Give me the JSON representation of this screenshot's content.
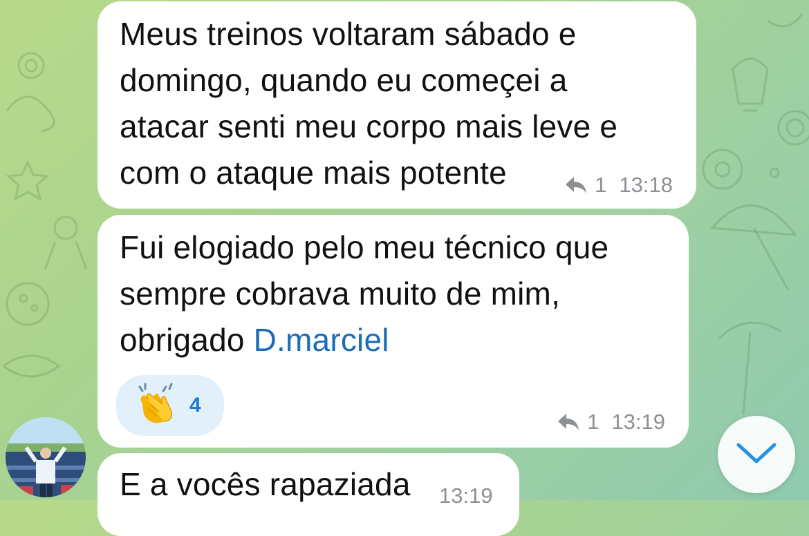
{
  "messages": [
    {
      "text_lines": [
        "Meus treinos voltaram sábado e",
        "domingo, quando eu começei a",
        "atacar senti meu corpo mais leve e",
        "com o ataque mais potente"
      ],
      "reply_count": "1",
      "time": "13:18"
    },
    {
      "text_lines": [
        "Fui elogiado pelo meu técnico que",
        "sempre cobrava muito de mim,",
        "obrigado "
      ],
      "mention": "D.marciel",
      "reaction": {
        "emoji_icon": "clapping-hands-icon",
        "count": "4"
      },
      "reply_count": "1",
      "time": "13:19"
    },
    {
      "text_lines": [
        "E a vocês rapaziada"
      ],
      "time": "13:19"
    }
  ],
  "colors": {
    "bubble": "#ffffff",
    "mention": "#1a6bb8",
    "meta": "#8c8f93",
    "reaction_bg": "#e2f0fb",
    "reaction_count": "#1d7ad6",
    "scroll_chevron": "#2a90e6"
  },
  "icons": {
    "reply": "reply-arrow-icon",
    "scroll": "chevron-down-icon",
    "avatar": "avatar"
  }
}
